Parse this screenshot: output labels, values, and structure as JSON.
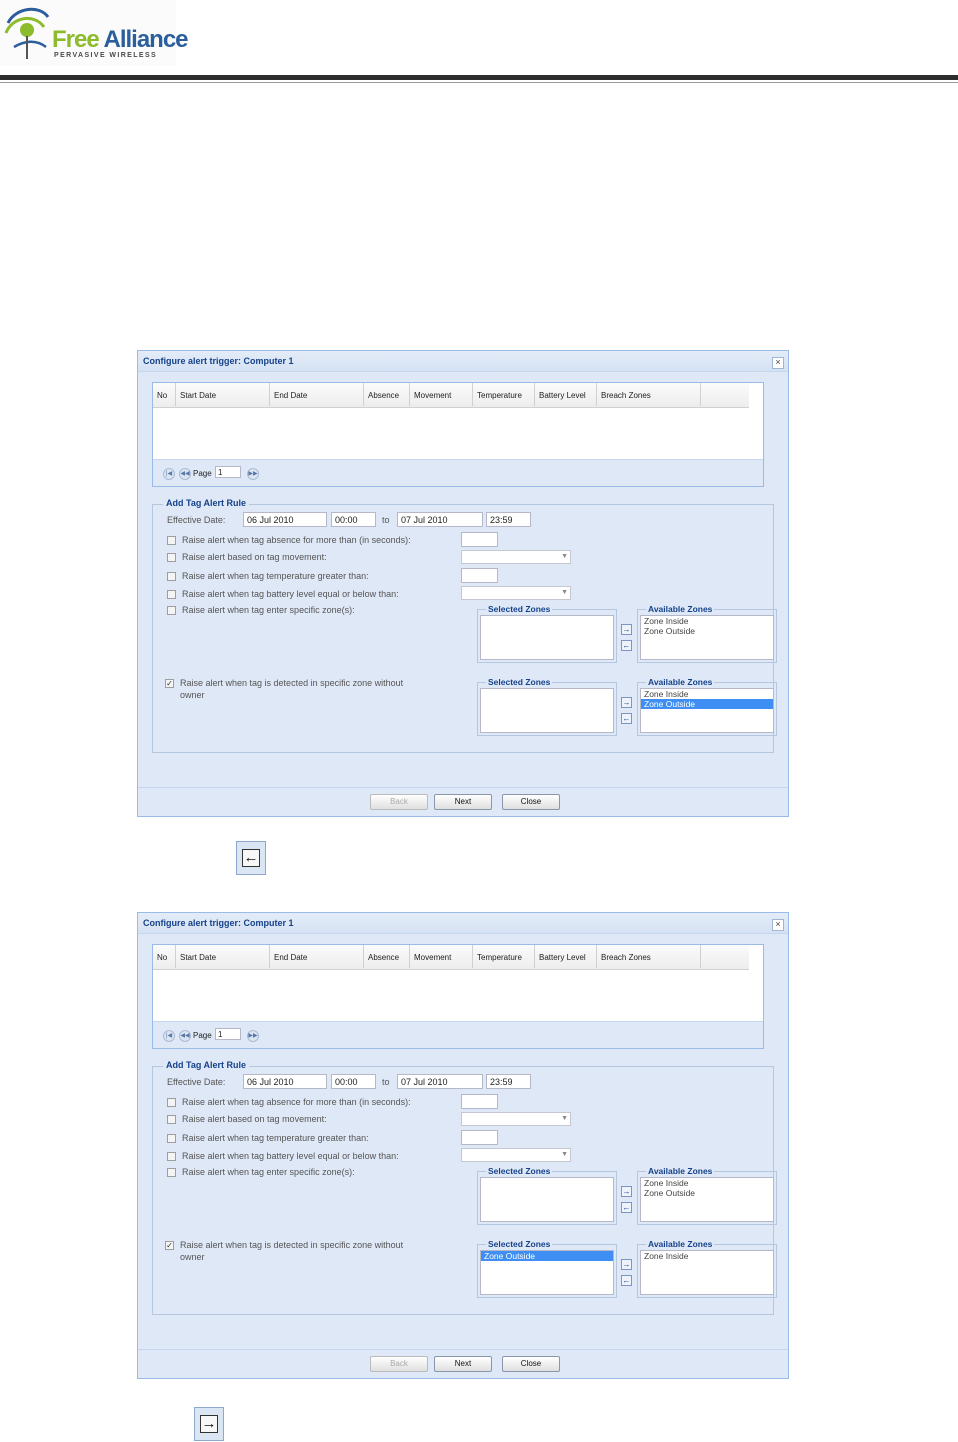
{
  "header": {
    "logo_word1": "Free",
    "logo_word2": "Alliance",
    "logo_tagline": "PERVASIVE WIRELESS"
  },
  "dialogs": [
    {
      "title": "Configure alert trigger: Computer 1",
      "close_glyph": "×",
      "columns": [
        "No",
        "Start Date",
        "End Date",
        "Absence",
        "Movement",
        "Temperature",
        "Battery Level",
        "Breach Zones"
      ],
      "pager": {
        "label": "Page",
        "value": "1"
      },
      "legend": "Add Tag Alert Rule",
      "effective_label": "Effective Date:",
      "start_date": "06 Jul 2010",
      "start_time": "00:00",
      "to_label": "to",
      "end_date": "07 Jul 2010",
      "end_time": "23:59",
      "rules": [
        {
          "label": "Raise alert when tag absence for more than (in seconds):",
          "checked": false
        },
        {
          "label": "Raise alert based on tag movement:",
          "checked": false
        },
        {
          "label": "Raise alert when tag temperature greater than:",
          "checked": false
        },
        {
          "label": "Raise alert when tag battery level equal or below than:",
          "checked": false
        },
        {
          "label": "Raise alert when tag enter specific zone(s):",
          "checked": false
        }
      ],
      "owner_rule": {
        "line1": "Raise alert when tag is detected in specific zone without",
        "line2": "owner",
        "checked": true
      },
      "zones1": {
        "selected_title": "Selected Zones",
        "available_title": "Available Zones",
        "selected": [],
        "available": [
          "Zone Inside",
          "Zone Outside"
        ]
      },
      "zones2": {
        "selected_title": "Selected Zones",
        "available_title": "Available Zones",
        "selected": [],
        "available": [
          "Zone Inside",
          "Zone Outside"
        ],
        "highlighted": "Zone Outside"
      },
      "buttons": {
        "back": "Back",
        "next": "Next",
        "close": "Close"
      }
    },
    {
      "title": "Configure alert trigger: Computer 1",
      "close_glyph": "×",
      "columns": [
        "No",
        "Start Date",
        "End Date",
        "Absence",
        "Movement",
        "Temperature",
        "Battery Level",
        "Breach Zones"
      ],
      "pager": {
        "label": "Page",
        "value": "1"
      },
      "legend": "Add Tag Alert Rule",
      "effective_label": "Effective Date:",
      "start_date": "06 Jul 2010",
      "start_time": "00:00",
      "to_label": "to",
      "end_date": "07 Jul 2010",
      "end_time": "23:59",
      "rules": [
        {
          "label": "Raise alert when tag absence for more than (in seconds):",
          "checked": false
        },
        {
          "label": "Raise alert based on tag movement:",
          "checked": false
        },
        {
          "label": "Raise alert when tag temperature greater than:",
          "checked": false
        },
        {
          "label": "Raise alert when tag battery level equal or below than:",
          "checked": false
        },
        {
          "label": "Raise alert when tag enter specific zone(s):",
          "checked": false
        }
      ],
      "owner_rule": {
        "line1": "Raise alert when tag is detected in specific zone without",
        "line2": "owner",
        "checked": true
      },
      "zones1": {
        "selected_title": "Selected Zones",
        "available_title": "Available Zones",
        "selected": [],
        "available": [
          "Zone Inside",
          "Zone Outside"
        ]
      },
      "zones2": {
        "selected_title": "Selected Zones",
        "available_title": "Available Zones",
        "selected": [
          "Zone Outside"
        ],
        "available": [
          "Zone Inside"
        ],
        "highlighted": "Zone Outside"
      },
      "buttons": {
        "back": "Back",
        "next": "Next",
        "close": "Close"
      }
    }
  ],
  "captions": {
    "left_arrow_icon": "left-arrow-icon",
    "right_arrow_icon": "right-arrow-icon"
  },
  "colors": {
    "header_accent": "#8dbb2c",
    "title_blue": "#15428b",
    "panel_bg": "#dfe8f6",
    "selection": "#3f8ef3"
  }
}
